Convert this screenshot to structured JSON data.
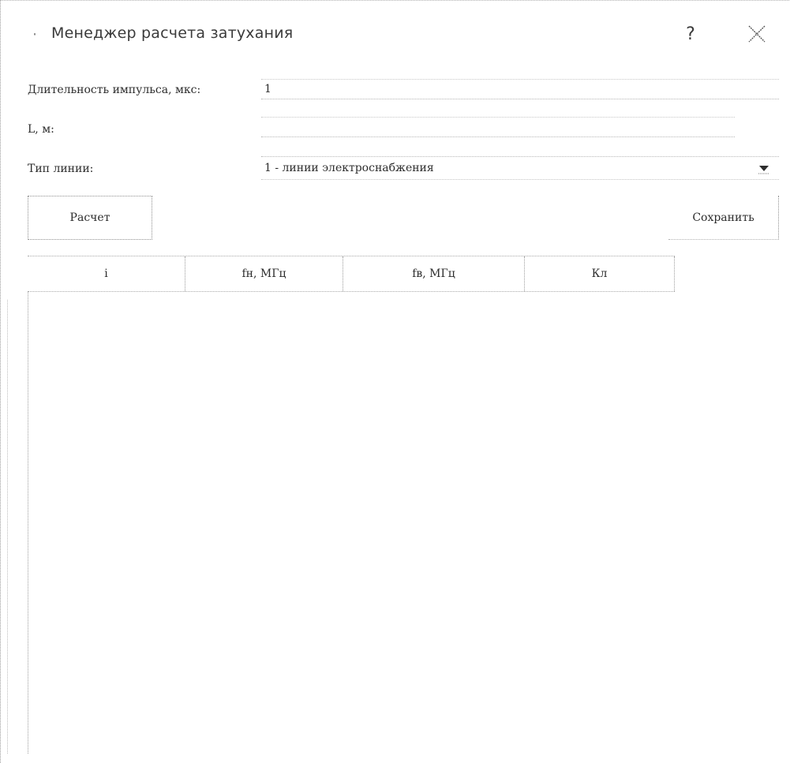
{
  "window": {
    "title": "Менеджер расчета затухания",
    "help_label": "?",
    "title_icon": "dot-icon",
    "close_icon": "close-icon"
  },
  "form": {
    "pulse_label": "Длительность импульса, мкс:",
    "pulse_value": "1",
    "length_label": "L, м:",
    "length_value": "",
    "line_type_label": "Тип линии:",
    "line_type_value": "1 - линии электроснабжения"
  },
  "buttons": {
    "calculate": "Расчет",
    "save": "Сохранить"
  },
  "table": {
    "headers": [
      "i",
      "fн, МГц",
      "fв, МГц",
      "Кл"
    ],
    "rows": []
  }
}
